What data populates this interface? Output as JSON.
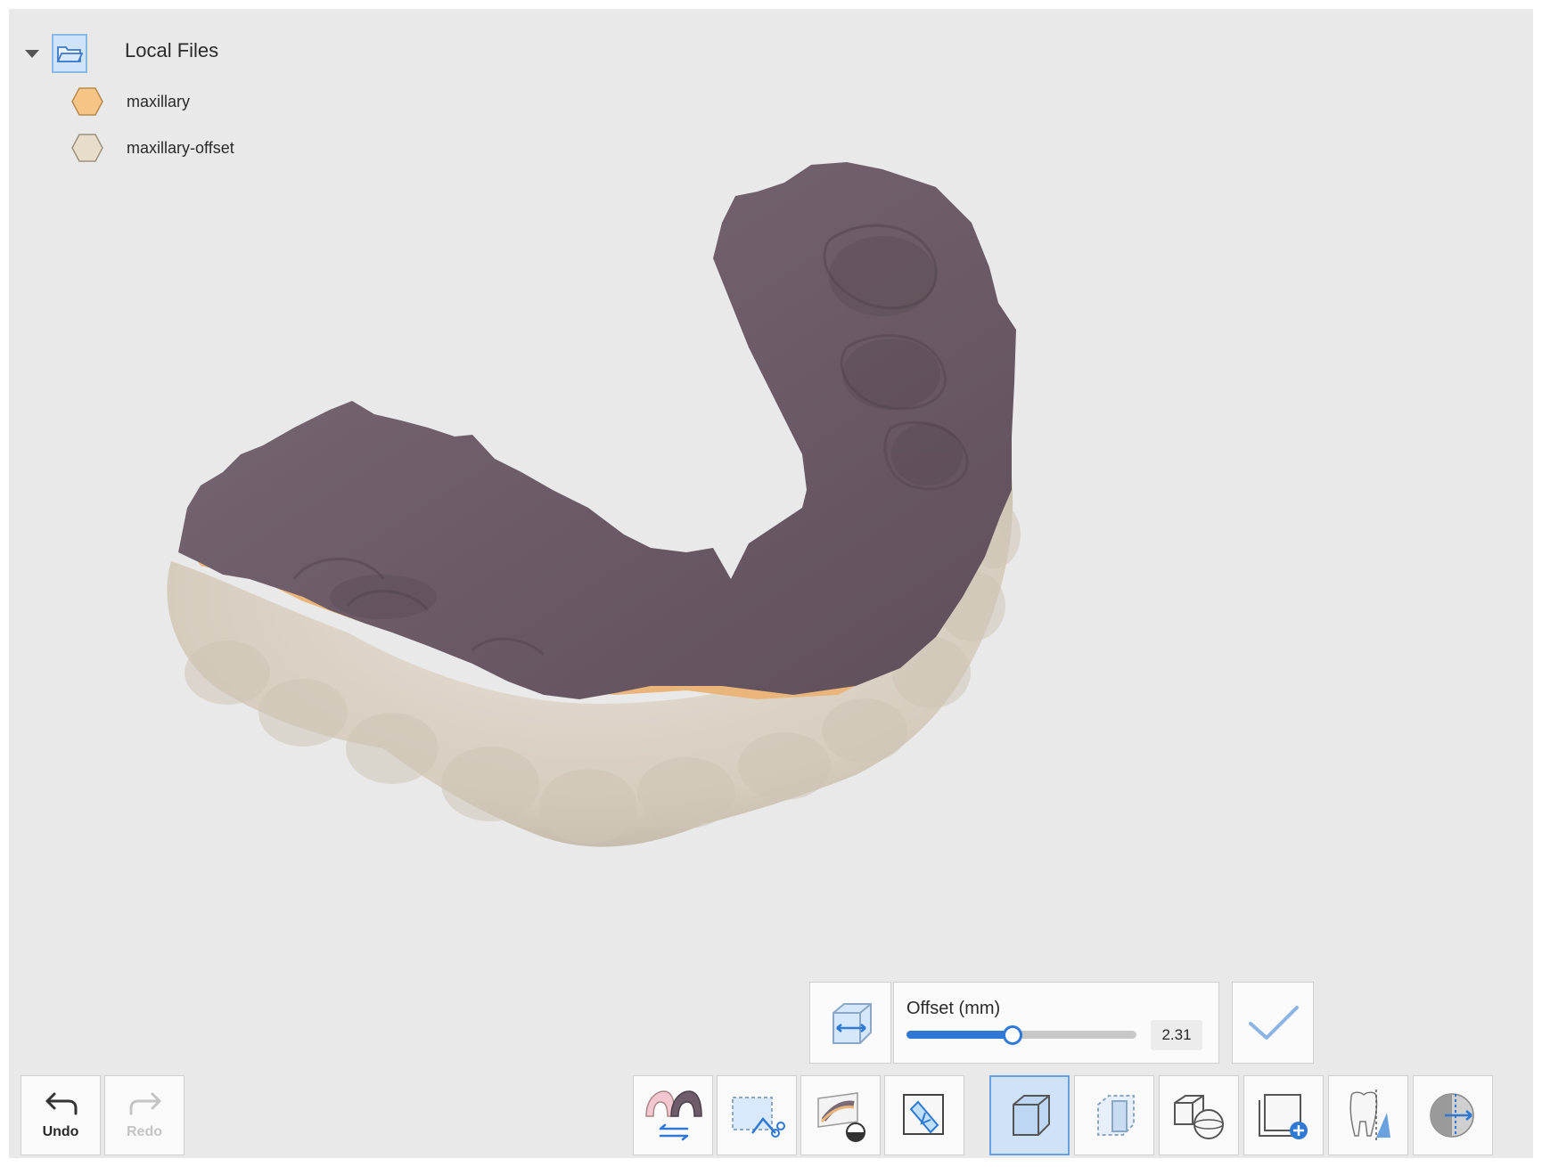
{
  "tree": {
    "title": "Local Files",
    "items": [
      {
        "label": "maxillary",
        "color": "#f6c586"
      },
      {
        "label": "maxillary-offset",
        "color": "#e8dccb"
      }
    ]
  },
  "model": {
    "upper_color": "#705f6b",
    "band_color": "#e9b57a",
    "lower_color": "#d8cfc2"
  },
  "offset_panel": {
    "label": "Offset (mm)",
    "value": "2.31",
    "slider_fraction": 0.46,
    "accent": "#2f78d4"
  },
  "history": {
    "undo_label": "Undo",
    "redo_label": "Redo"
  },
  "toolbar": {
    "tools": [
      {
        "icon": "jaw-switch-icon"
      },
      {
        "icon": "select-trim-icon"
      },
      {
        "icon": "cross-section-icon"
      },
      {
        "icon": "annotate-tool-icon"
      },
      {
        "icon": "solid-box-icon",
        "active": true
      },
      {
        "icon": "transparent-box-icon"
      },
      {
        "icon": "cube-sphere-icon"
      },
      {
        "icon": "add-view-icon"
      },
      {
        "icon": "tooth-clip-icon"
      },
      {
        "icon": "globe-direction-icon"
      }
    ]
  }
}
